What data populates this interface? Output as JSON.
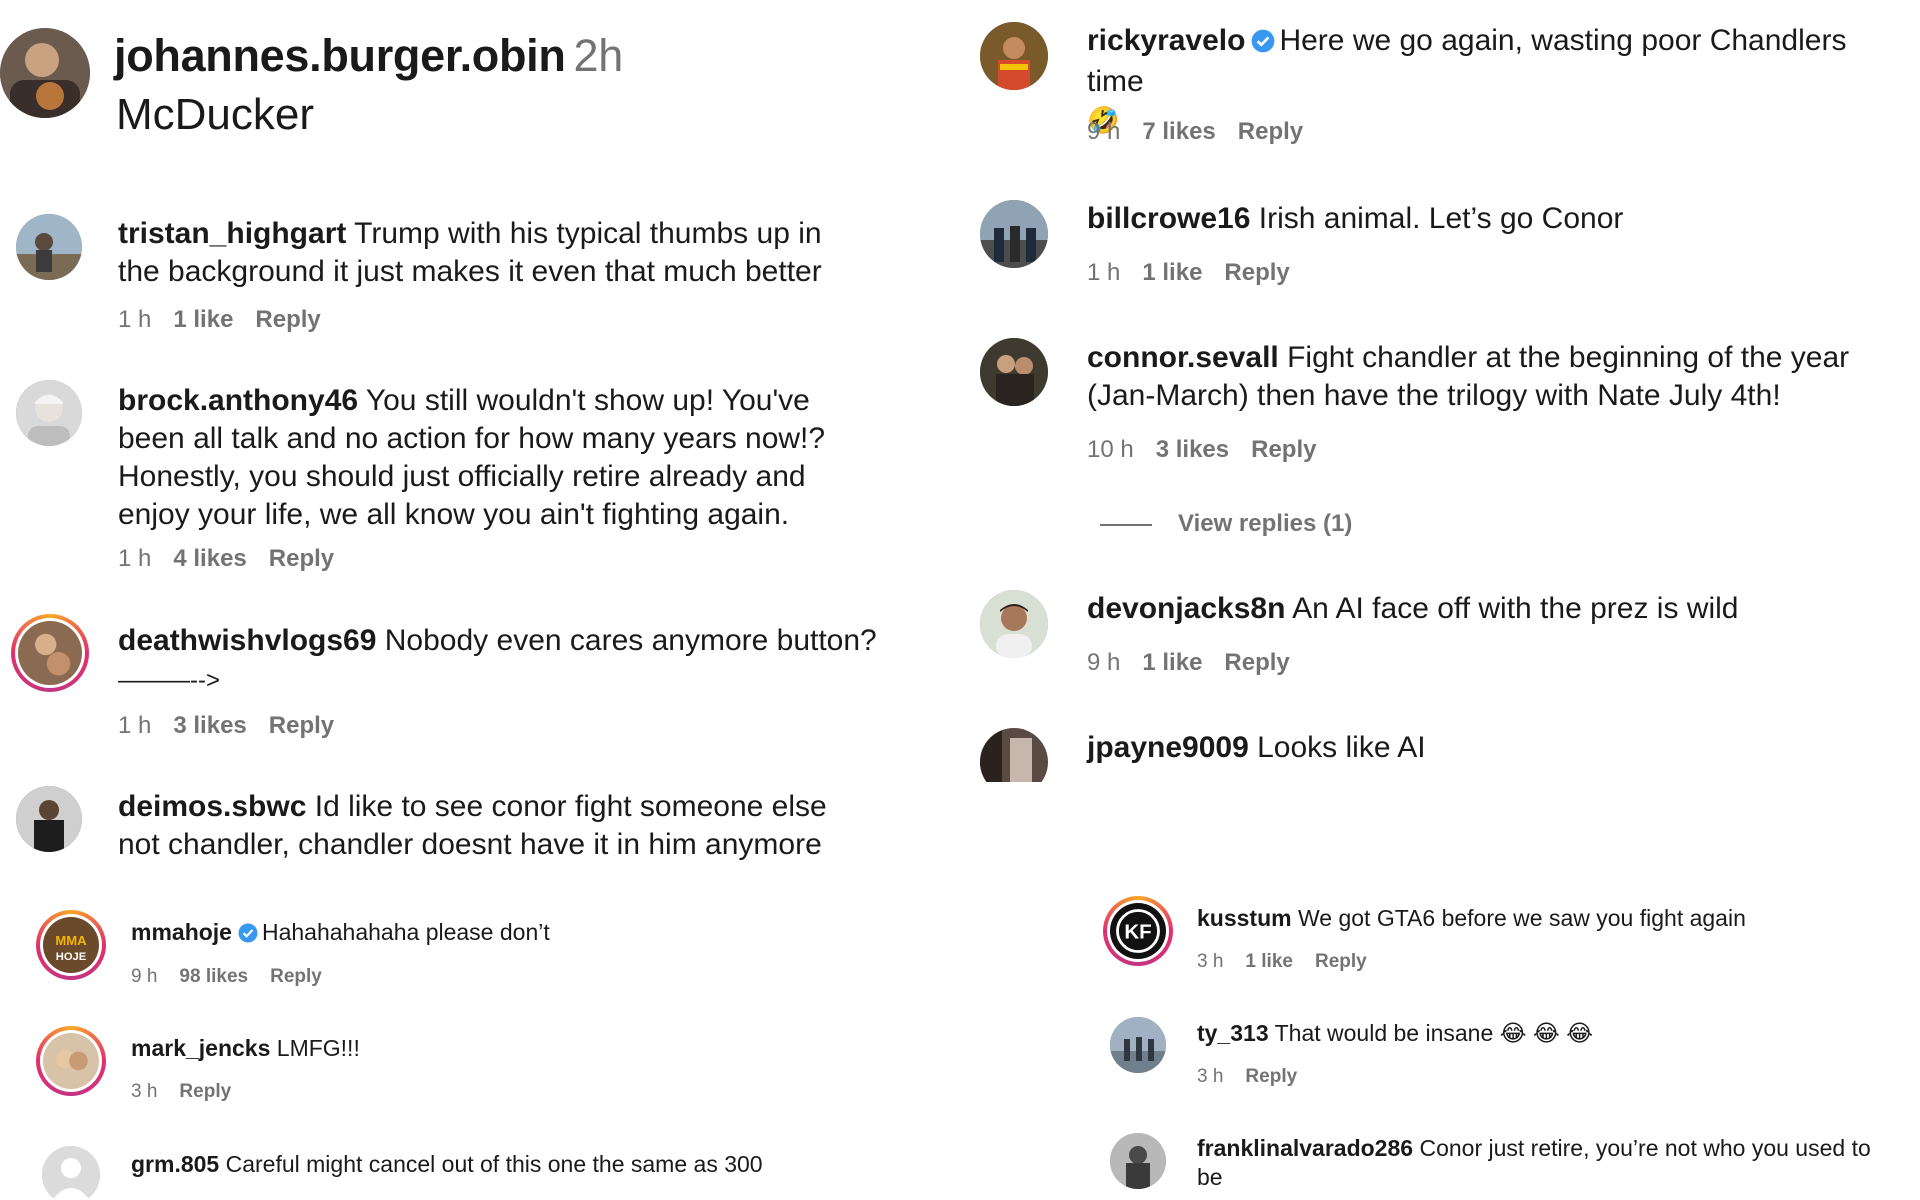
{
  "header": {
    "username": "johannes.burger.obin",
    "time": "2h",
    "caption": "McDucker"
  },
  "left_comments": [
    {
      "user": "tristan_highgart",
      "text": "Trump with his typical thumbs up in the background it just makes it even that much better",
      "time": "1 h",
      "likes": "1 like",
      "reply": "Reply"
    },
    {
      "user": "brock.anthony46",
      "text": "You still wouldn't show up! You've been all talk and no action for how many years now!? Honestly, you should just officially retire already and enjoy your life, we all know you ain't fighting again.",
      "time": "1 h",
      "likes": "4 likes",
      "reply": "Reply"
    },
    {
      "user": "deathwishvlogs69",
      "text": "Nobody even cares anymore button?",
      "text2": "———-->",
      "time": "1 h",
      "likes": "3 likes",
      "reply": "Reply"
    },
    {
      "user": "deimos.sbwc",
      "text": "Id like to see conor fight someone else not chandler, chandler doesnt have it in him anymore"
    }
  ],
  "left_small": [
    {
      "user": "mmahoje",
      "verified": true,
      "text": "Hahahahahaha please don’t",
      "time": "9 h",
      "likes": "98 likes",
      "reply": "Reply"
    },
    {
      "user": "mark_jencks",
      "text": "LMFG!!!",
      "time": "3 h",
      "reply": "Reply"
    },
    {
      "user": "grm.805",
      "text": "Careful might cancel out of this one the same as 300"
    }
  ],
  "right_comments": [
    {
      "user": "rickyravelo",
      "verified": true,
      "text": "Here we go again, wasting poor Chandlers time",
      "emoji": "🤣",
      "time": "9 h",
      "likes": "7 likes",
      "reply": "Reply"
    },
    {
      "user": "billcrowe16",
      "text": "Irish animal. Let’s go Conor",
      "time": "1 h",
      "likes": "1 like",
      "reply": "Reply"
    },
    {
      "user": "connor.sevall",
      "text": "Fight chandler at the beginning of the year (Jan-March) then have the trilogy with Nate July 4th!",
      "time": "10 h",
      "likes": "3 likes",
      "reply": "Reply"
    },
    {
      "user": "devonjacks8n",
      "text": "An AI face off with the prez is wild",
      "time": "9 h",
      "likes": "1 like",
      "reply": "Reply"
    },
    {
      "user": "jpayne9009",
      "text": "Looks like AI"
    }
  ],
  "view_replies": "View replies (1)",
  "right_small": [
    {
      "user": "kusstum",
      "text": "We got GTA6 before we saw you fight again",
      "time": "3 h",
      "likes": "1 like",
      "reply": "Reply"
    },
    {
      "user": "ty_313",
      "text": "That would be insane",
      "emoji": "😂 😂 😂",
      "time": "3 h",
      "reply": "Reply"
    },
    {
      "user": "franklinalvarado286",
      "text": "Conor just retire, you’re not who you used to be"
    }
  ],
  "colors": {
    "meta_gray": "#737373",
    "verified_blue": "#3897f0",
    "story_ring_a": "#f9a826",
    "story_ring_b": "#e1306c"
  }
}
